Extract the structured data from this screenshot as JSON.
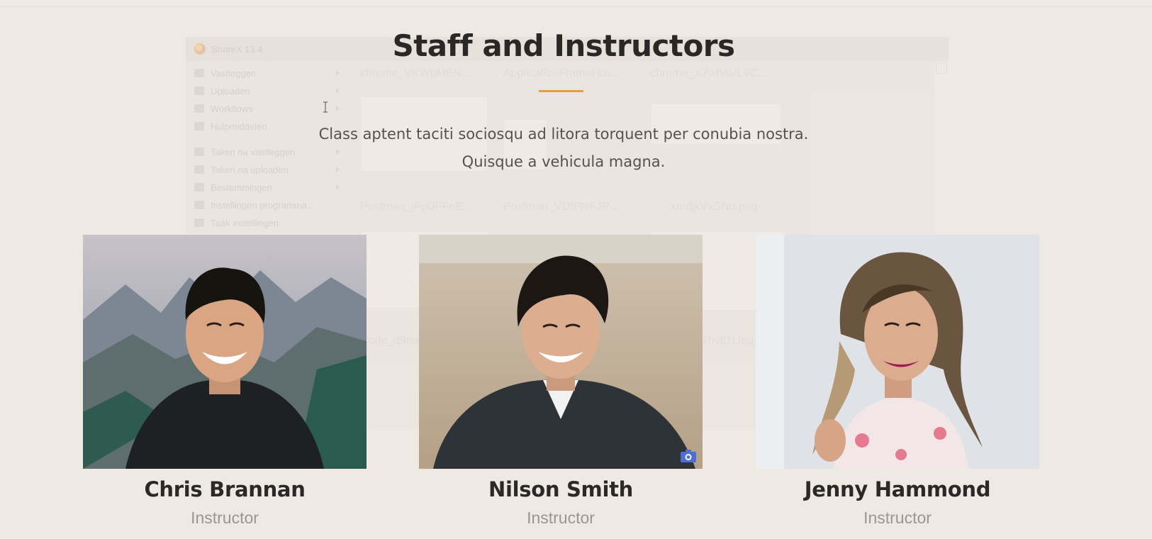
{
  "section": {
    "title": "Staff and Instructors",
    "subtitle": "Class aptent taciti sociosqu ad litora torquent per conubia nostra. Quisque a vehicula magna.",
    "accent_color": "#e89a45"
  },
  "staff": [
    {
      "name": "Chris Brannan",
      "role": "Instructor"
    },
    {
      "name": "Nilson Smith",
      "role": "Instructor"
    },
    {
      "name": "Jenny Hammond",
      "role": "Instructor"
    }
  ],
  "overlay": {
    "app_title": "ShareX 13.4",
    "menu": [
      "Vastleggen",
      "Uploaden",
      "Workflows",
      "Hulpmiddelen",
      "Taken na vastleggen",
      "Taken na uploaden",
      "Bestemmingen",
      "Instellingen programma...",
      "Taak instellingen"
    ],
    "files": [
      "chrome_VKWpMEN...",
      "ApplicationFrameHos...",
      "chrome_X7whAVL9C...",
      "Postman_jFyOFFnE...",
      "Postman_VDfPNFJR...",
      "xmdjkVxSNu.png",
      "Code_q9naBCbOWq...",
      "Postman_Thvtl1Lleq..."
    ]
  }
}
